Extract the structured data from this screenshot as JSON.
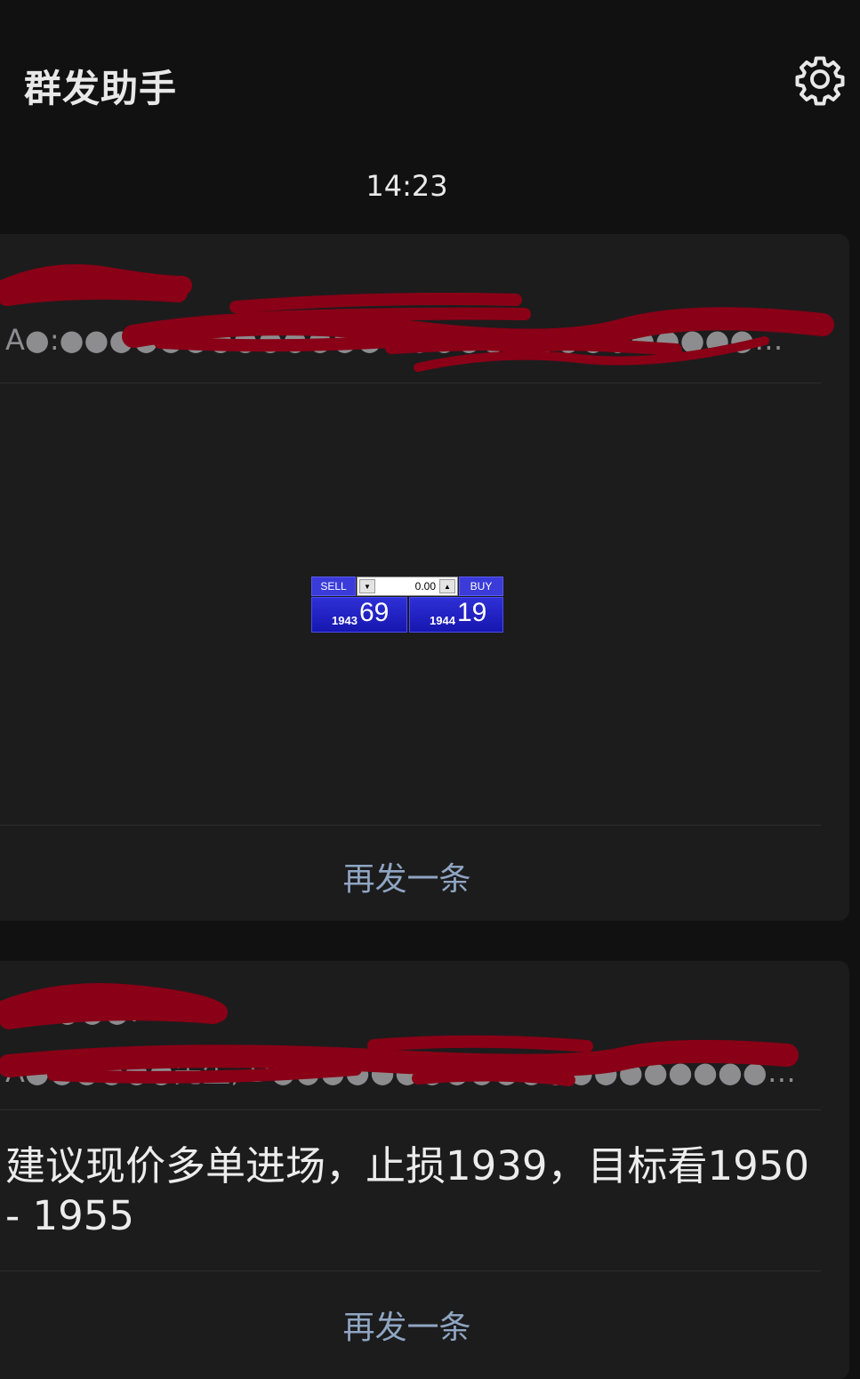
{
  "header": {
    "title": "群发助手",
    "settings_icon": "gear-icon"
  },
  "timestamp": "14:23",
  "cards": [
    {
      "sender_line": "●●●●●:",
      "recipients_line": "A●:●●●●●●●●●●●●●●●●●●●●●●●●●●●●●●●●●●●●●●●●●●...",
      "widget": {
        "sell_label": "SELL",
        "buy_label": "BUY",
        "lot_value": "0.00",
        "spin_down": "▼",
        "spin_up": "▲",
        "sell_price_small": "1943",
        "sell_price_big": "69",
        "buy_price_small": "1944",
        "buy_price_big": "19"
      },
      "resend_label": "再发一条"
    },
    {
      "sender_line": "●●●●●:",
      "recipients_line": "A●●●●●●先生, D●●●●●●●●●●●●●●●●●●●●●●●●●●●●●●●●3.3东先生, ...",
      "message": "建议现价多单进场，止损1939，目标看1950 - 1955",
      "resend_label": "再发一条"
    }
  ],
  "colors": {
    "background": "#111112",
    "card": "#1c1c1d",
    "link": "#8fa5c2",
    "redaction": "#8a0016"
  }
}
